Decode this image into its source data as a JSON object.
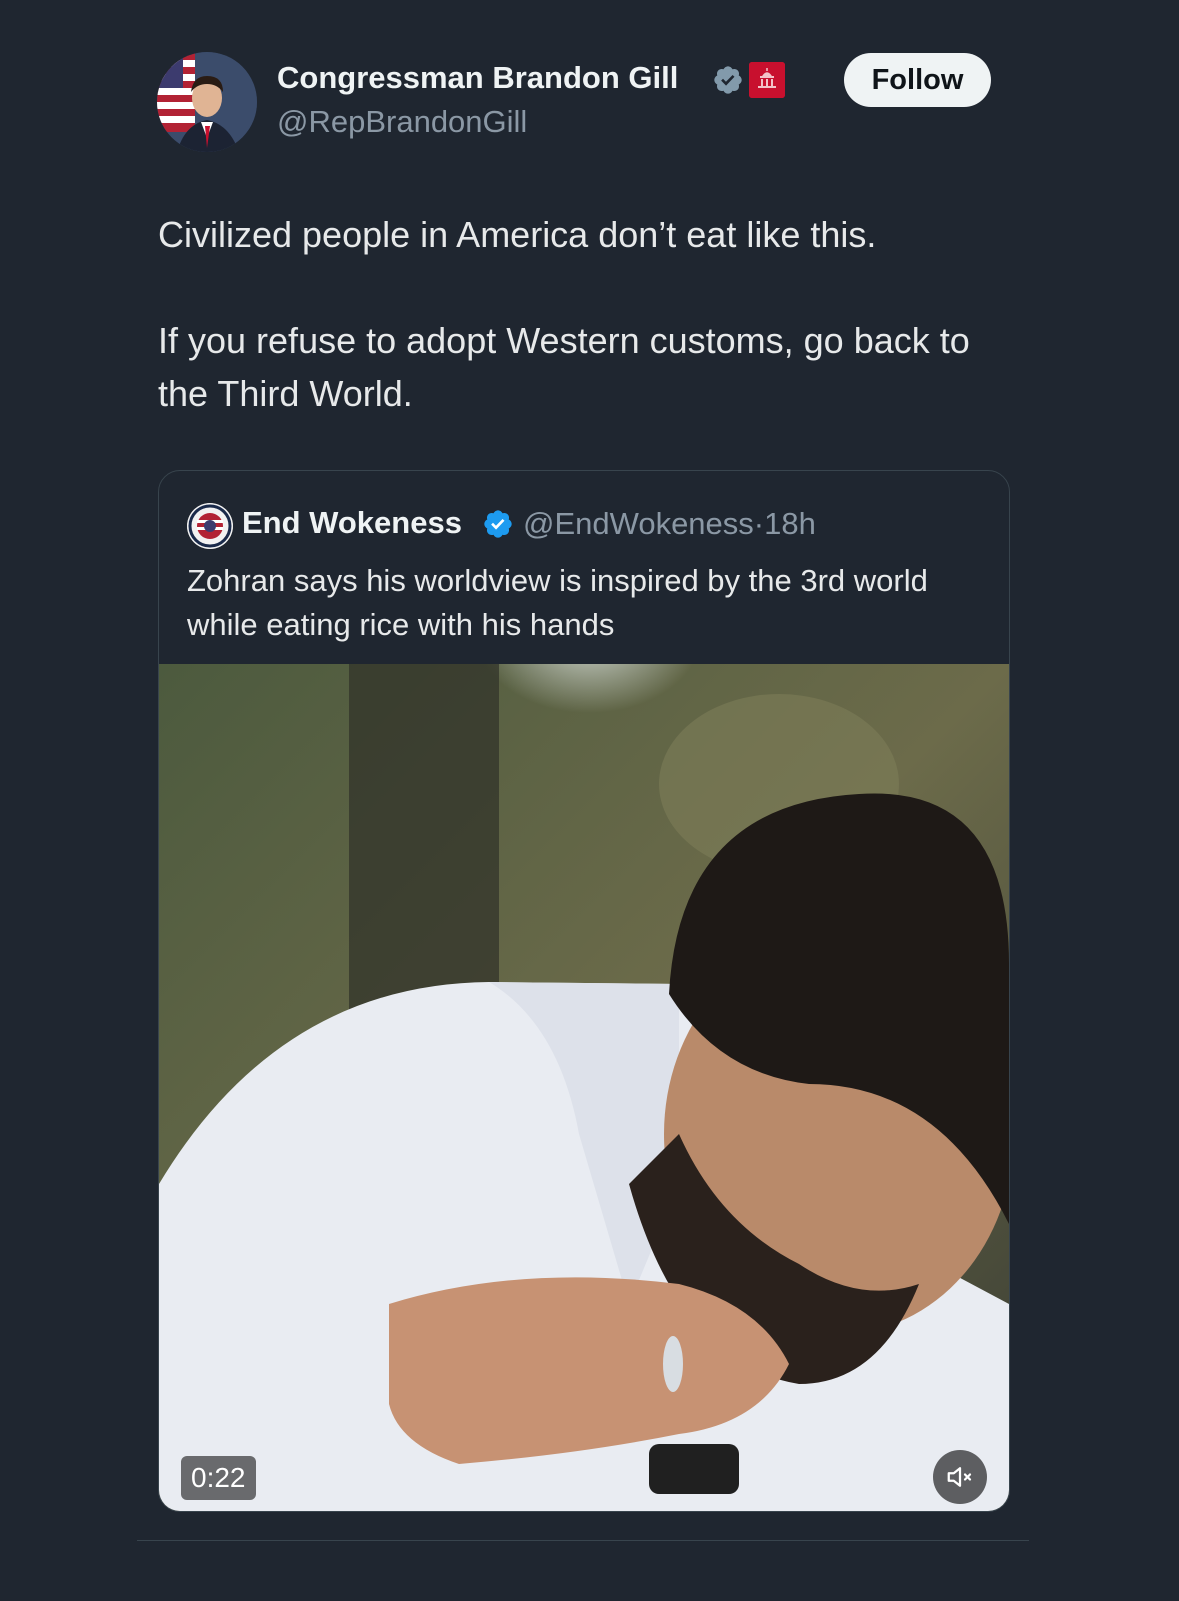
{
  "post": {
    "author_name": "Congressman Brandon Gill",
    "author_handle": "@RepBrandonGill",
    "follow_label": "Follow",
    "paragraph_1": "Civilized people in America don’t eat like this.",
    "paragraph_2": "If you refuse to adopt Western customs, go back to the Third World.",
    "verified_icon": "grey-verified-badge-icon",
    "gov_icon": "capitol-badge-icon"
  },
  "quoted_post": {
    "author_name": "End Wokeness",
    "author_handle": "@EndWokeness",
    "separator": "·",
    "time_ago": "18h",
    "text": "Zohran says his worldview is inspired by the 3rd world while eating rice with his hands",
    "verified_icon": "blue-verified-badge-icon",
    "video": {
      "duration": "0:22",
      "mute_icon": "speaker-muted-icon"
    }
  },
  "colors": {
    "background": "#1f2630",
    "text_primary": "#e7e9ea",
    "text_secondary": "#8b98a5",
    "verified_blue": "#1d9bf0",
    "verified_grey": "#829aab",
    "border": "#38444d"
  }
}
